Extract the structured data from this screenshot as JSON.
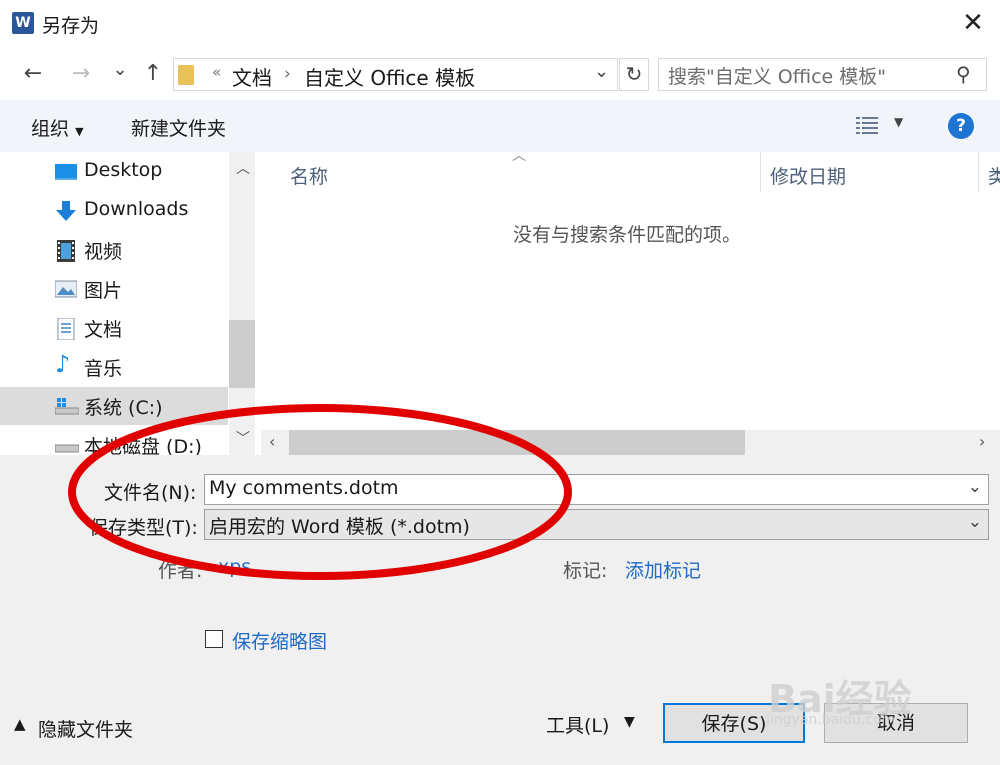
{
  "window": {
    "title": "另存为",
    "app_icon_letter": "W"
  },
  "nav_buttons": {
    "back": "←",
    "forward": "→",
    "recent": "⌄",
    "up": "↑",
    "refresh": "↻"
  },
  "address": {
    "double_chevron": "«",
    "crumbs": [
      "文档",
      "自定义 Office 模板"
    ],
    "separator": "›"
  },
  "search": {
    "placeholder": "搜索\"自定义 Office 模板\""
  },
  "toolbar": {
    "organize": "组织",
    "new_folder": "新建文件夹",
    "help": "?"
  },
  "nav_pane": {
    "items": [
      {
        "label": "Desktop",
        "icon": "desktop-icon"
      },
      {
        "label": "Downloads",
        "icon": "download-arrow-icon"
      },
      {
        "label": "视频",
        "icon": "video-icon"
      },
      {
        "label": "图片",
        "icon": "picture-icon"
      },
      {
        "label": "文档",
        "icon": "document-icon"
      },
      {
        "label": "音乐",
        "icon": "music-note-icon"
      },
      {
        "label": "系统 (C:)",
        "icon": "windows-drive-icon",
        "selected": true
      },
      {
        "label": "本地磁盘 (D:)",
        "icon": "drive-icon"
      }
    ]
  },
  "file_list": {
    "columns": [
      "名称",
      "修改日期",
      "类型"
    ],
    "empty_message": "没有与搜索条件匹配的项。"
  },
  "form": {
    "filename_label": "文件名(N):",
    "filename_value": "My comments.dotm",
    "filetype_label": "保存类型(T):",
    "filetype_value": "启用宏的 Word 模板 (*.dotm)",
    "author_label": "作者:",
    "author_value": "xps",
    "tags_label": "标记:",
    "tags_value": "添加标记",
    "thumbnail_label": "保存缩略图",
    "thumbnail_checked": false
  },
  "footer": {
    "hide_folders": "隐藏文件夹",
    "tools": "工具(L)",
    "save": "保存(S)",
    "cancel": "取消"
  },
  "colors": {
    "accent": "#0078d7",
    "link": "#1f6bc6",
    "annotation": "#e00000",
    "toolbar_bg": "#f1f4f9"
  },
  "watermark": {
    "text": "Bai",
    "text2": "经验",
    "sub": "jingyan.baidu.com"
  }
}
